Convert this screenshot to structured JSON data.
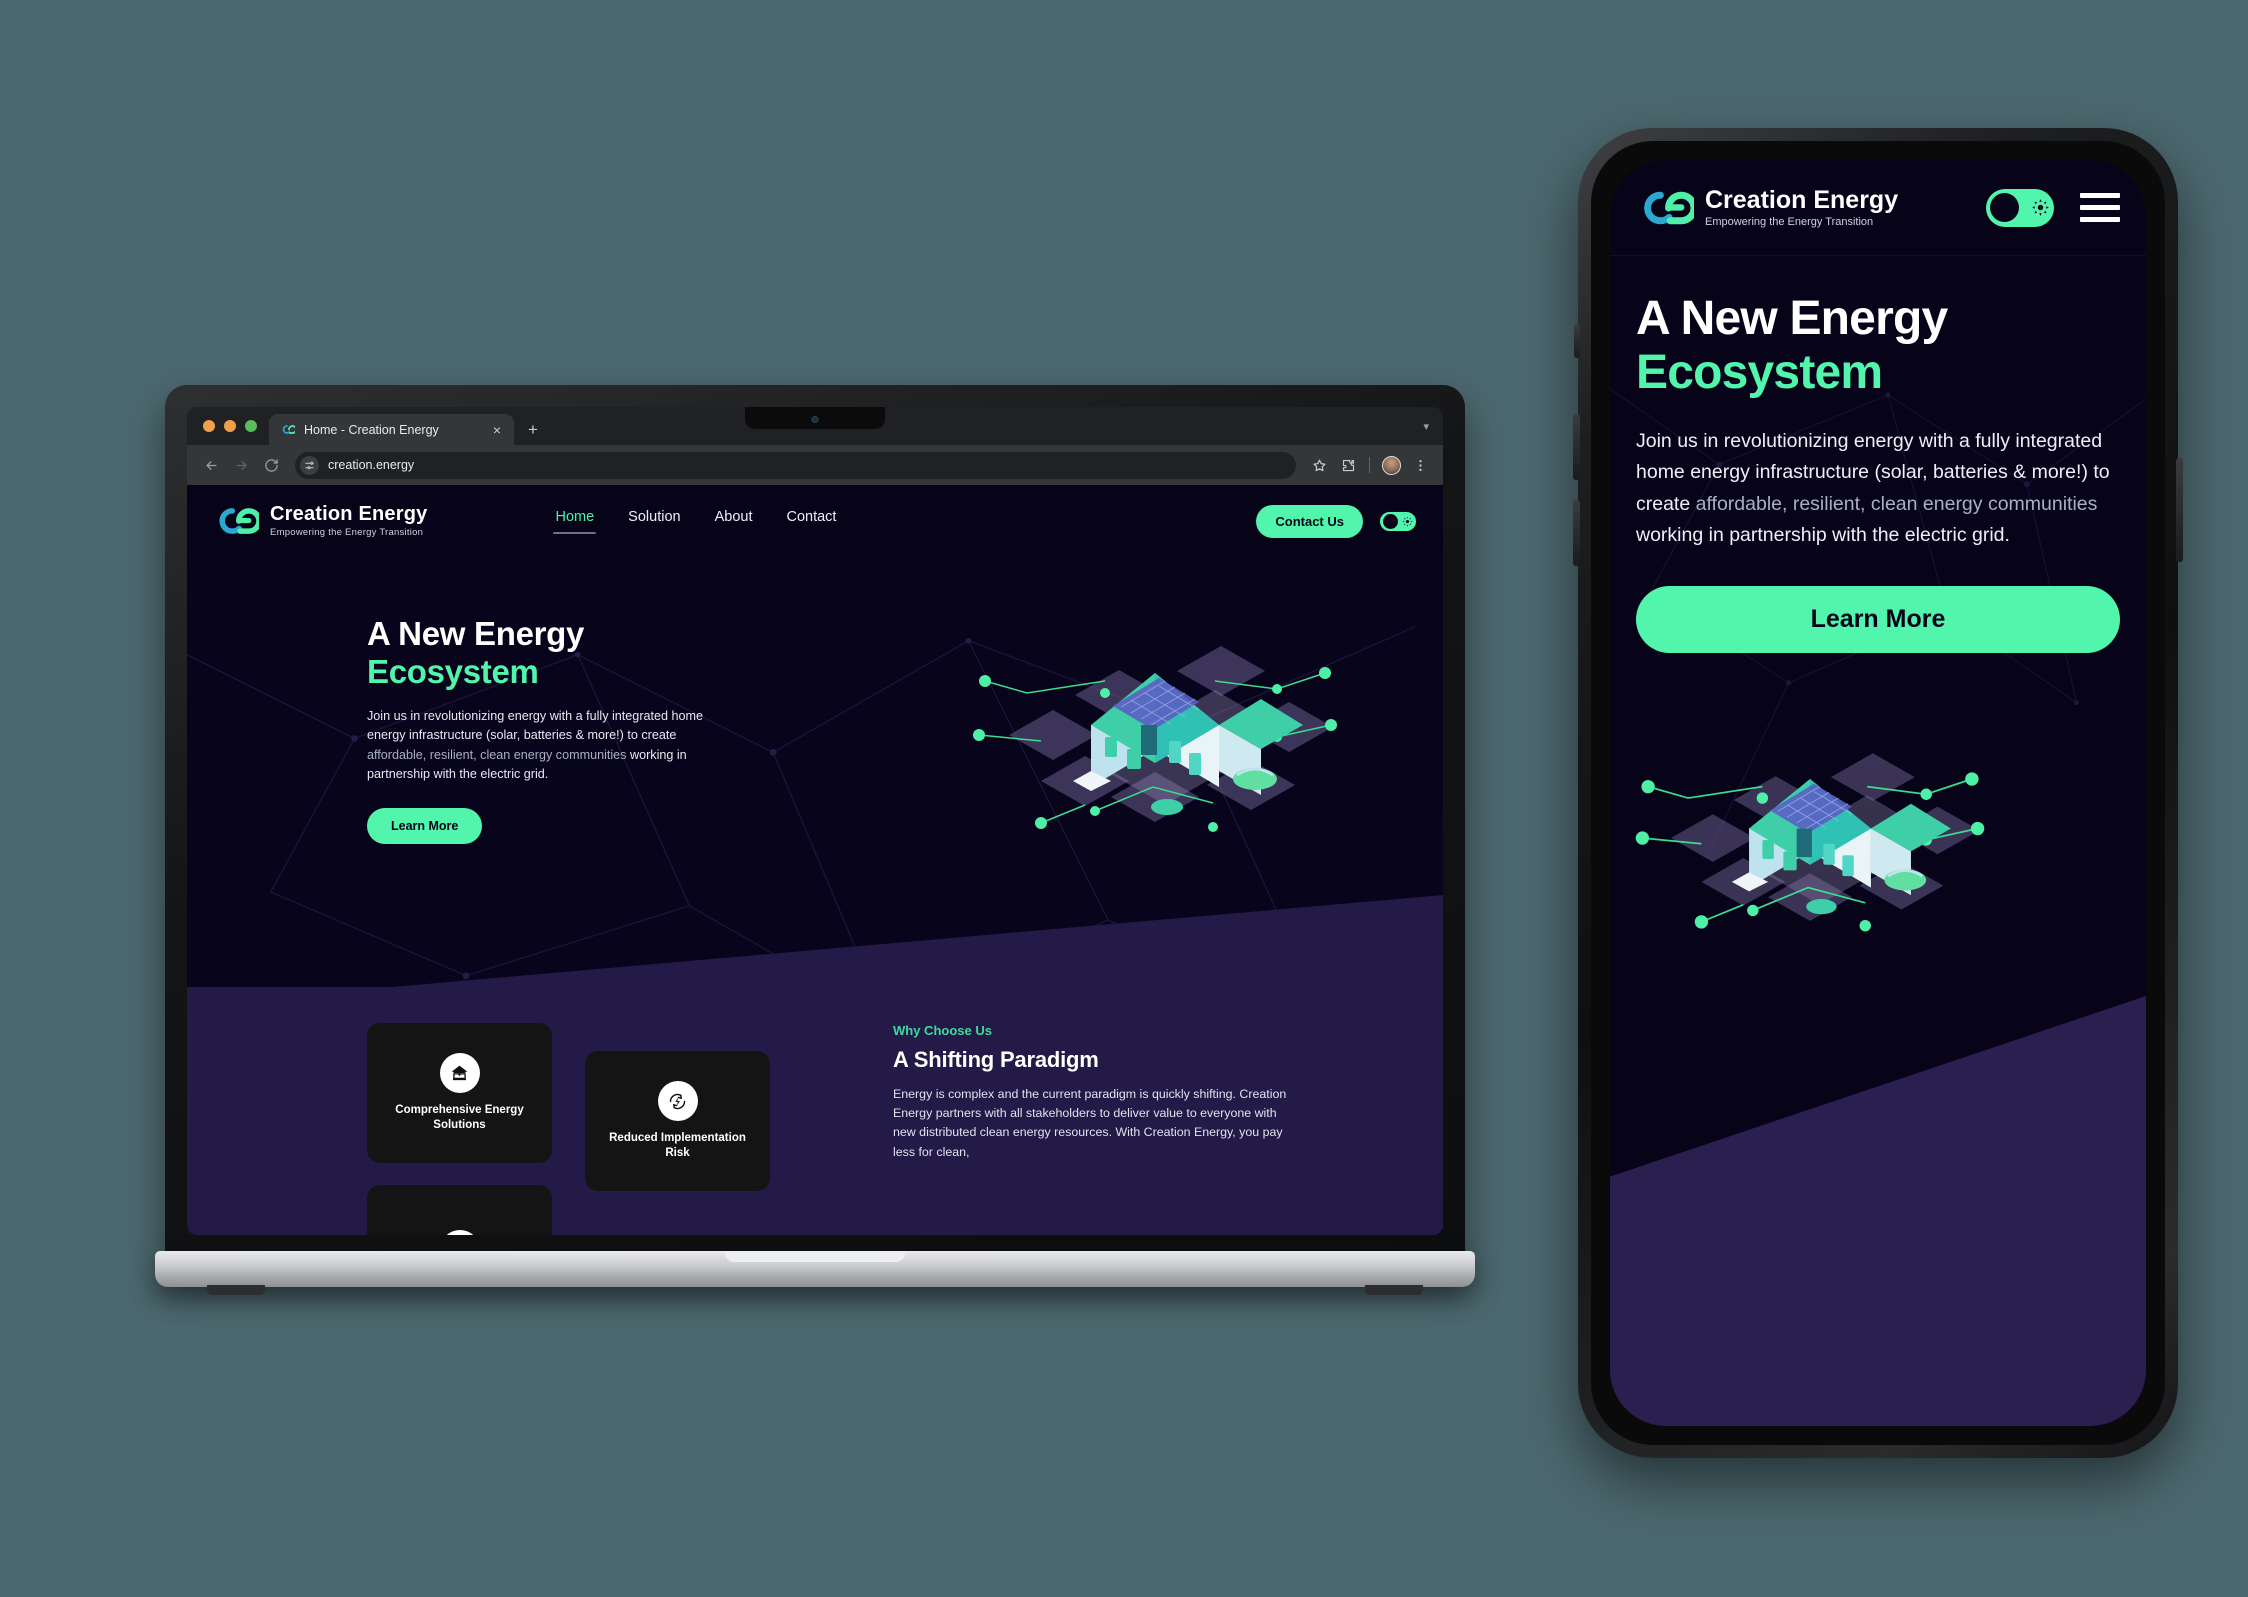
{
  "browser": {
    "tab_title": "Home - Creation Energy",
    "tab_favicon": "ce-logo-icon",
    "new_tab_label": "+",
    "close_tab_label": "×",
    "url": "creation.energy",
    "back_icon": "back-arrow-icon",
    "forward_icon": "forward-arrow-icon",
    "reload_icon": "reload-icon",
    "site_settings_icon": "tune-icon",
    "bookmark_icon": "star-icon",
    "extensions_icon": "puzzle-icon",
    "profile_icon": "avatar-icon",
    "menu_icon": "three-dot-menu-icon"
  },
  "site": {
    "brand": {
      "name": "Creation Energy",
      "tagline": "Empowering the Energy Transition",
      "logo_icon": "ce-monogram-logo"
    },
    "nav": [
      {
        "label": "Home",
        "active": true
      },
      {
        "label": "Solution",
        "active": false
      },
      {
        "label": "About",
        "active": false
      },
      {
        "label": "Contact",
        "active": false
      }
    ],
    "cta_label": "Contact Us",
    "theme_toggle": {
      "state": "on",
      "icon": "gear-sun-icon"
    },
    "hero": {
      "title_line1": "A New Energy",
      "title_line2": "Ecosystem",
      "paragraph_parts": [
        {
          "text": "Join us in revolutionizing energy with a fully integrated home energy infrastructure (solar, batteries & more!) to create ",
          "dim": false
        },
        {
          "text": "affordable, resilient, clean energy communities ",
          "dim": true
        },
        {
          "text": "working in partnership with the electric grid.",
          "dim": false
        }
      ],
      "button_label": "Learn More",
      "illustration": "isometric-solar-home-illustration"
    },
    "cards": [
      {
        "title": "Comprehensive Energy Solutions",
        "icon": "home-leaf-icon"
      },
      {
        "title": "Reduced Implementation Risk",
        "icon": "bolt-recycle-icon"
      },
      {
        "title": "",
        "icon": "partial-card-icon"
      }
    ],
    "why": {
      "eyebrow": "Why Choose Us",
      "title": "A Shifting Paradigm",
      "body": "Energy is complex and the current paradigm is quickly shifting. Creation Energy partners with all stakeholders to deliver value to everyone with new distributed clean energy resources. With Creation Energy, you pay less for clean,"
    }
  },
  "phone": {
    "menu_icon": "hamburger-menu-icon",
    "theme_toggle": {
      "state": "on",
      "icon": "gear-sun-icon"
    }
  },
  "colors": {
    "canvas": "#4c686f",
    "accent_green": "#52f5ac",
    "eyebrow_green": "#3fd99b",
    "hero_dark": "#08041c",
    "purple": "#241a47",
    "phone_purple": "#2a1f4f",
    "card_bg": "#141414"
  }
}
